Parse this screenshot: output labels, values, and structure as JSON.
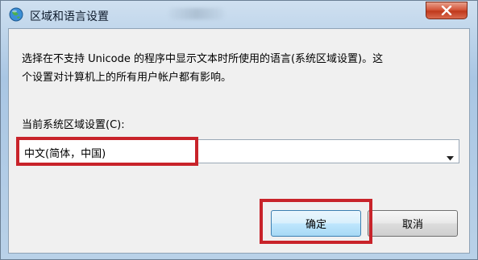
{
  "window": {
    "title": "区域和语言设置",
    "close_glyph": "✕"
  },
  "dialog": {
    "description_line1": "选择在不支持 Unicode 的程序中显示文本时所使用的语言(系统区域设置)。这",
    "description_line2": "个设置对计算机上的所有用户帐户都有影响。",
    "current_locale_label": "当前系统区域设置(C):",
    "current_locale_value": "中文(简体，中国)",
    "ok_label": "确定",
    "cancel_label": "取消"
  },
  "colors": {
    "highlight": "#c8232a",
    "close_button": "#c0391c",
    "default_button_border": "#3c7fb1"
  },
  "icons": {
    "title": "globe-icon",
    "close": "close-icon",
    "dropdown": "chevron-down-icon"
  }
}
